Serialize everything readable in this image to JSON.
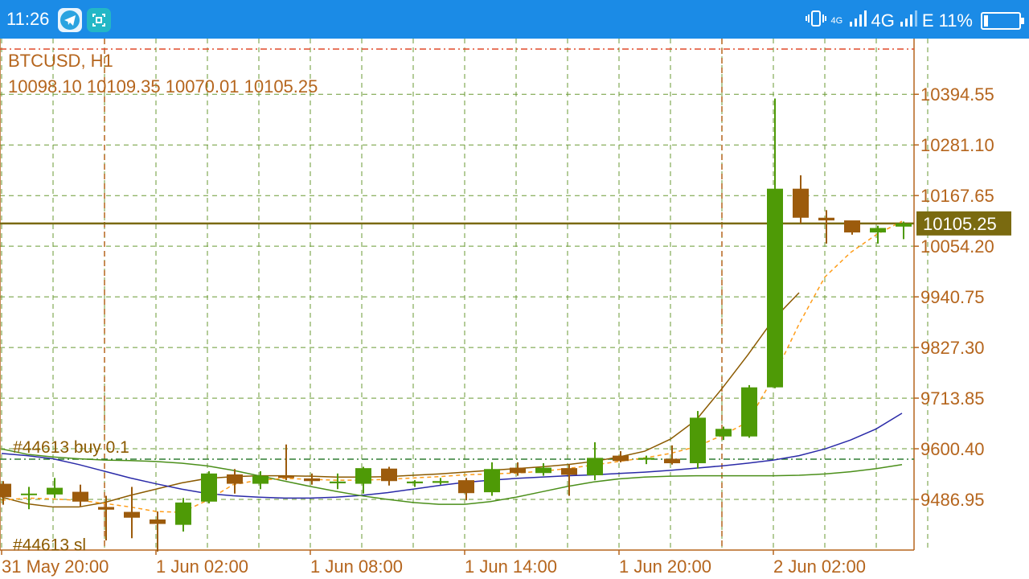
{
  "status_bar": {
    "time": "11:26",
    "network": "4G",
    "net_badge": "4G",
    "carrier2": "E",
    "battery": "11%",
    "battery_level": 0.11
  },
  "chart_data": {
    "type": "candlestick",
    "symbol_label": "BTCUSD, H1",
    "ohlc_label": "10098.10 10109.35 10070.01 10105.25",
    "current_price_label": "10105.25",
    "current_price": 10105.25,
    "ylim": [
      9373.5,
      10519.3
    ],
    "y_ticks": [
      "10394.55",
      "10281.10",
      "10167.65",
      "10054.20",
      "9940.75",
      "9827.30",
      "9713.85",
      "9600.40",
      "9486.95"
    ],
    "x_ticks": [
      "31 May 20:00",
      "1 Jun 02:00",
      "1 Jun 08:00",
      "1 Jun 14:00",
      "1 Jun 20:00",
      "2 Jun 02:00"
    ],
    "annotations": {
      "buy_label": "#44613 buy 0.1",
      "buy_price": 9577,
      "sl_label": "#44613 sl",
      "sl_price": 9387
    },
    "candles": [
      {
        "o": 9522,
        "h": 9528,
        "l": 9475,
        "c": 9492
      },
      {
        "o": 9499,
        "h": 9515,
        "l": 9465,
        "c": 9500
      },
      {
        "o": 9498,
        "h": 9535,
        "l": 9490,
        "c": 9513
      },
      {
        "o": 9504,
        "h": 9520,
        "l": 9470,
        "c": 9482
      },
      {
        "o": 9470,
        "h": 9495,
        "l": 9395,
        "c": 9464
      },
      {
        "o": 9459,
        "h": 9515,
        "l": 9400,
        "c": 9446
      },
      {
        "o": 9442,
        "h": 9460,
        "l": 9370,
        "c": 9432
      },
      {
        "o": 9430,
        "h": 9490,
        "l": 9415,
        "c": 9480
      },
      {
        "o": 9482,
        "h": 9550,
        "l": 9478,
        "c": 9545
      },
      {
        "o": 9543,
        "h": 9555,
        "l": 9500,
        "c": 9522
      },
      {
        "o": 9522,
        "h": 9550,
        "l": 9510,
        "c": 9540
      },
      {
        "o": 9540,
        "h": 9610,
        "l": 9530,
        "c": 9535
      },
      {
        "o": 9534,
        "h": 9545,
        "l": 9520,
        "c": 9528
      },
      {
        "o": 9523,
        "h": 9545,
        "l": 9510,
        "c": 9527
      },
      {
        "o": 9522,
        "h": 9560,
        "l": 9500,
        "c": 9557
      },
      {
        "o": 9556,
        "h": 9560,
        "l": 9518,
        "c": 9528
      },
      {
        "o": 9523,
        "h": 9530,
        "l": 9515,
        "c": 9527
      },
      {
        "o": 9524,
        "h": 9535,
        "l": 9520,
        "c": 9528
      },
      {
        "o": 9530,
        "h": 9535,
        "l": 9485,
        "c": 9501
      },
      {
        "o": 9503,
        "h": 9570,
        "l": 9495,
        "c": 9555
      },
      {
        "o": 9558,
        "h": 9570,
        "l": 9540,
        "c": 9546
      },
      {
        "o": 9546,
        "h": 9568,
        "l": 9540,
        "c": 9558
      },
      {
        "o": 9557,
        "h": 9565,
        "l": 9495,
        "c": 9542
      },
      {
        "o": 9541,
        "h": 9615,
        "l": 9530,
        "c": 9580
      },
      {
        "o": 9585,
        "h": 9595,
        "l": 9570,
        "c": 9573
      },
      {
        "o": 9576,
        "h": 9585,
        "l": 9566,
        "c": 9580
      },
      {
        "o": 9578,
        "h": 9608,
        "l": 9565,
        "c": 9568
      },
      {
        "o": 9568,
        "h": 9685,
        "l": 9556,
        "c": 9670
      },
      {
        "o": 9628,
        "h": 9650,
        "l": 9620,
        "c": 9645
      },
      {
        "o": 9628,
        "h": 9743,
        "l": 9625,
        "c": 9738
      },
      {
        "o": 9738,
        "h": 10385,
        "l": 9736,
        "c": 10183
      },
      {
        "o": 10183,
        "h": 10213,
        "l": 10105,
        "c": 10118
      },
      {
        "o": 10118,
        "h": 10135,
        "l": 10060,
        "c": 10112
      },
      {
        "o": 10112,
        "h": 10110,
        "l": 10080,
        "c": 10085
      },
      {
        "o": 10085,
        "h": 10100,
        "l": 10060,
        "c": 10095
      },
      {
        "o": 10098.1,
        "h": 10109.35,
        "l": 10070.01,
        "c": 10105.25
      }
    ],
    "series": [
      {
        "color": "#8b5a00",
        "style": "solid",
        "start": 0,
        "values": [
          9492,
          9477,
          9470,
          9470,
          9480,
          9496,
          9510,
          9524,
          9534,
          9538,
          9540,
          9540,
          9539,
          9537,
          9537,
          9538,
          9541,
          9544,
          9548,
          9552,
          9556,
          9560,
          9565,
          9572,
          9582,
          9595,
          9622,
          9665,
          9735,
          9810,
          9890,
          9950
        ]
      },
      {
        "color": "#2a2aa8",
        "style": "solid",
        "start": 0,
        "values": [
          9590,
          9585,
          9578,
          9565,
          9550,
          9535,
          9522,
          9510,
          9500,
          9495,
          9492,
          9490,
          9490,
          9492,
          9496,
          9502,
          9510,
          9518,
          9525,
          9530,
          9534,
          9537,
          9540,
          9542,
          9545,
          9548,
          9552,
          9557,
          9562,
          9568,
          9575,
          9585,
          9600,
          9620,
          9645,
          9680
        ]
      },
      {
        "color": "#4b8f1a",
        "style": "solid",
        "start": 0,
        "values": [
          9600,
          9588,
          9582,
          9578,
          9575,
          9574,
          9572,
          9568,
          9562,
          9552,
          9540,
          9528,
          9516,
          9505,
          9495,
          9487,
          9480,
          9476,
          9476,
          9482,
          9492,
          9504,
          9516,
          9526,
          9533,
          9537,
          9539,
          9540,
          9540,
          9540,
          9540,
          9541,
          9544,
          9549,
          9556,
          9565
        ]
      },
      {
        "color": "#ff9d19",
        "style": "dash",
        "start": 0,
        "values": [
          9485,
          9490,
          9488,
          9485,
          9478,
          9470,
          9460,
          9458,
          9485,
          9520,
          9530,
          9534,
          9532,
          9530,
          9530,
          9532,
          9535,
          9538,
          9542,
          9544,
          9546,
          9550,
          9556,
          9564,
          9572,
          9580,
          9590,
          9605,
          9630,
          9660,
          9760,
          9880,
          9985,
          10040,
          10080,
          10110
        ]
      }
    ]
  }
}
